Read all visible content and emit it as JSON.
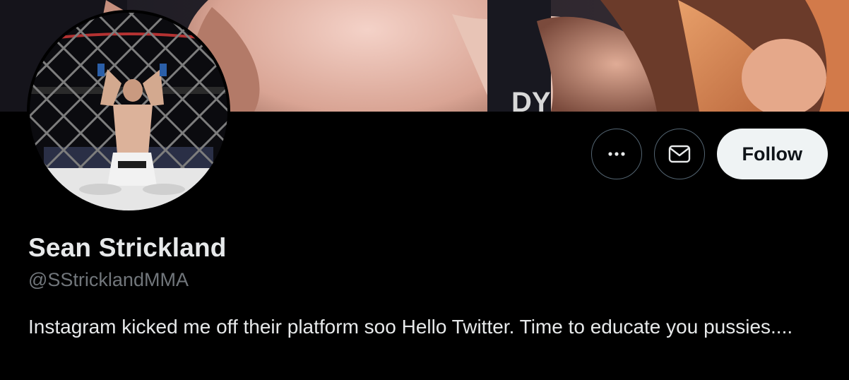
{
  "profile": {
    "display_name": "Sean Strickland",
    "handle": "@SStricklandMMA",
    "bio": "Instagram kicked me off their platform soo Hello Twitter. Time to educate you pussies...."
  },
  "actions": {
    "more_icon": "more-horizontal-icon",
    "message_icon": "envelope-icon",
    "follow_label": "Follow"
  },
  "colors": {
    "background": "#000000",
    "primary_text": "#e7e9ea",
    "secondary_text": "#71767b",
    "follow_button_bg": "#eff3f4",
    "button_border": "#536471"
  }
}
